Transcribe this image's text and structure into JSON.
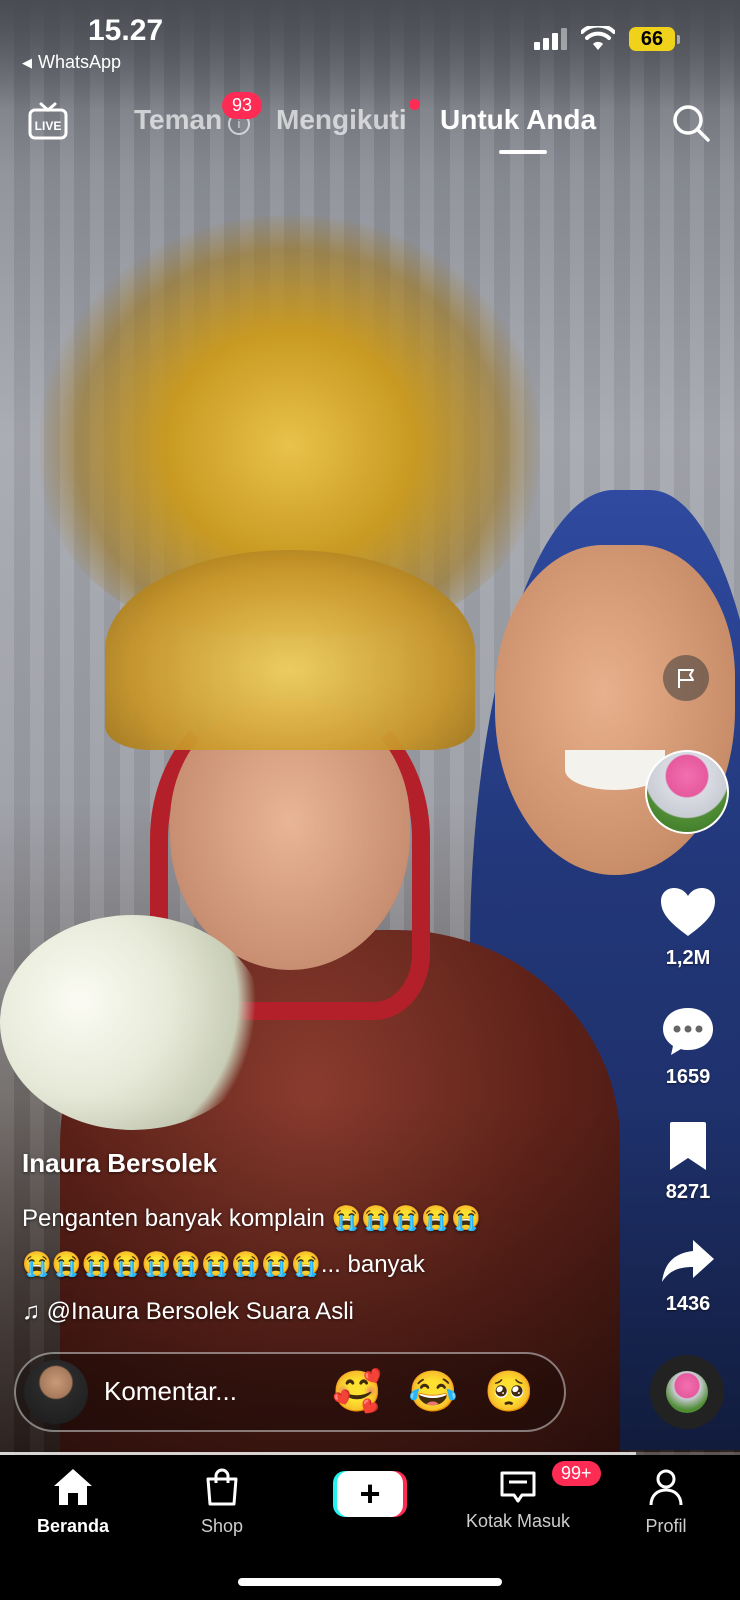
{
  "status_bar": {
    "time": "15.27",
    "back_app": "WhatsApp",
    "battery": "66"
  },
  "top_nav": {
    "tabs": [
      {
        "label": "Teman",
        "badge": "93"
      },
      {
        "label": "Mengikuti"
      },
      {
        "label": "Untuk Anda",
        "active": true
      }
    ],
    "live_label": "LIVE"
  },
  "actions": {
    "likes": "1,2M",
    "comments": "1659",
    "saves": "8271",
    "shares": "1436"
  },
  "post": {
    "username": "Inaura  Bersolek",
    "caption_line1": "Penganten banyak komplain 😭😭😭😭😭",
    "caption_line2": "😭😭😭😭😭😭😭😭😭😭... banyak",
    "music": "♫ @Inaura  Bersolek Suara Asli"
  },
  "comment_bar": {
    "placeholder": "Komentar...",
    "quick_emojis": [
      "🥰",
      "😂",
      "🥺"
    ]
  },
  "progress": 0.86,
  "bottom_nav": {
    "items": [
      {
        "label": "Beranda",
        "icon": "home-icon",
        "active": true
      },
      {
        "label": "Shop",
        "icon": "shopping-bag-icon"
      },
      {
        "label": "",
        "icon": "plus-icon"
      },
      {
        "label": "Kotak Masuk",
        "icon": "inbox-icon",
        "badge": "99+"
      },
      {
        "label": "Profil",
        "icon": "profile-icon"
      }
    ]
  },
  "colors": {
    "accent": "#fe2c55",
    "cyan": "#25f4ee",
    "battery": "#f1d21b"
  }
}
